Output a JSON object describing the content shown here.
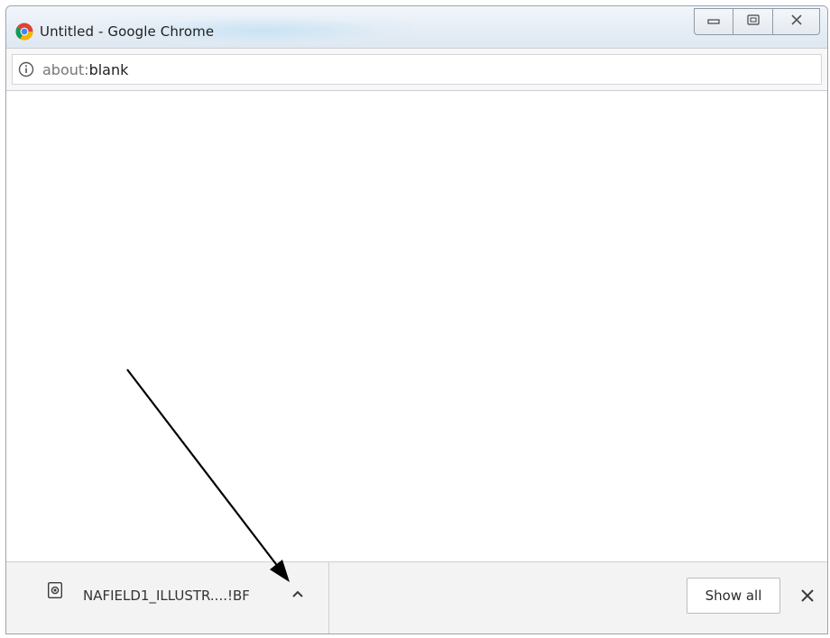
{
  "window": {
    "title": "Untitled - Google Chrome",
    "app_icon": "chrome-icon",
    "controls": [
      "minimize-icon",
      "maximize-icon",
      "close-icon"
    ]
  },
  "omnibox": {
    "icon": "info-icon",
    "url_scheme": "about:",
    "url_host": "blank"
  },
  "download_bar": {
    "file_icon": "file-icon",
    "file_name": "NAFIELD1_ILLUSTR....!BF",
    "menu_icon": "chevron-up-icon",
    "show_all_label": "Show all",
    "close_icon": "close-icon"
  },
  "annotation": {
    "type": "arrow",
    "color": "#000000",
    "points_to": "download-menu-button"
  },
  "colors": {
    "titlebar": "#e6edf5",
    "download_bar": "#f3f3f3",
    "content": "#ffffff"
  }
}
